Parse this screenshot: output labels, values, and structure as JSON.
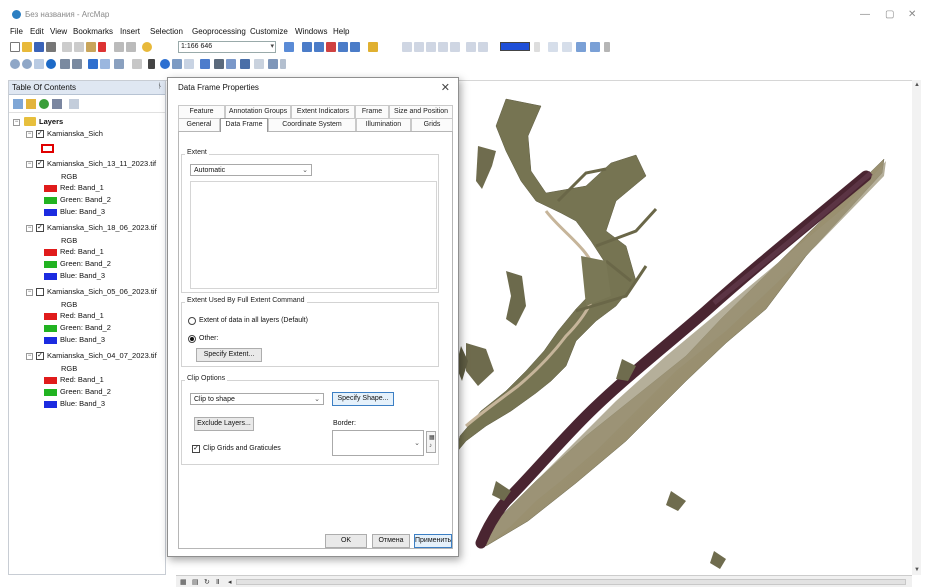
{
  "window": {
    "title": "Без названия - ArcMap",
    "controls": {
      "minimize": "—",
      "maximize": "▢",
      "close": "✕"
    }
  },
  "menu": [
    "File",
    "Edit",
    "View",
    "Bookmarks",
    "Insert",
    "Selection",
    "Geoprocessing",
    "Customize",
    "Windows",
    "Help"
  ],
  "toolbar": {
    "scale": "1:166 646",
    "highlight_color": "#1f4fd8"
  },
  "toc": {
    "title": "Table Of Contents",
    "pin": "ᚾ",
    "root_label": "Layers",
    "layers": [
      {
        "name": "Kamianska_Sich",
        "checked": true,
        "kind": "polygon",
        "symbol_color": "#e00000"
      },
      {
        "name": "Kamianska_Sich_13_11_2023.tif",
        "checked": true,
        "kind": "raster",
        "rgb_label": "RGB",
        "bands": [
          "Red:   Band_1",
          "Green: Band_2",
          "Blue:  Band_3"
        ]
      },
      {
        "name": "Kamianska_Sich_18_06_2023.tif",
        "checked": true,
        "kind": "raster",
        "rgb_label": "RGB",
        "bands": [
          "Red:   Band_1",
          "Green: Band_2",
          "Blue:  Band_3"
        ]
      },
      {
        "name": "Kamianska_Sich_05_06_2023.tif",
        "checked": false,
        "kind": "raster",
        "rgb_label": "RGB",
        "bands": [
          "Red:   Band_1",
          "Green: Band_2",
          "Blue:  Band_3"
        ]
      },
      {
        "name": "Kamianska_Sich_04_07_2023.tif",
        "checked": true,
        "kind": "raster",
        "rgb_label": "RGB",
        "bands": [
          "Red:   Band_1",
          "Green: Band_2",
          "Blue:  Band_3"
        ]
      }
    ],
    "band_colors": [
      "#e01b1b",
      "#21b321",
      "#1b2be0"
    ]
  },
  "dialog": {
    "title": "Data Frame Properties",
    "close": "✕",
    "tabs_row1": [
      "Feature Cache",
      "Annotation Groups",
      "Extent Indicators",
      "Frame",
      "Size and Position"
    ],
    "tabs_row2": [
      "General",
      "Data Frame",
      "Coordinate System",
      "Illumination",
      "Grids"
    ],
    "active_tab": "Data Frame",
    "extent": {
      "group_label": "Extent",
      "mode": "Automatic"
    },
    "full_extent": {
      "group_label": "Extent Used By Full Extent Command",
      "option_all": "Extent of data in all layers (Default)",
      "option_other": "Other:",
      "selected": "Other:",
      "specify_extent_button": "Specify Extent..."
    },
    "clip": {
      "group_label": "Clip Options",
      "mode": "Clip to shape",
      "specify_shape_button": "Specify Shape...",
      "exclude_layers_button": "Exclude Layers...",
      "border_label": "Border:",
      "clip_grids_label": "Clip Grids and Graticules",
      "clip_grids_checked": true
    },
    "buttons": {
      "ok": "OK",
      "cancel": "Отмена",
      "apply": "Применить"
    }
  }
}
